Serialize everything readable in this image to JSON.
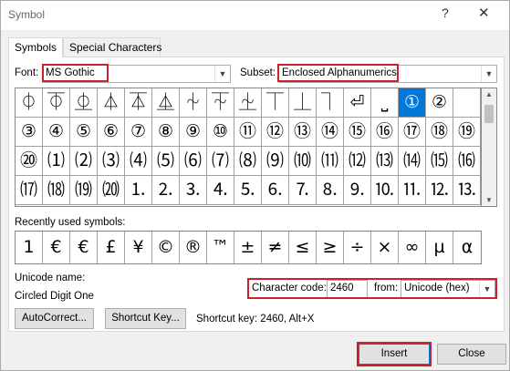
{
  "window": {
    "title": "Symbol",
    "help_glyph": "?",
    "close_glyph": "✕"
  },
  "tabs": [
    {
      "label": "Symbols",
      "active": true
    },
    {
      "label": "Special Characters",
      "active": false
    }
  ],
  "font": {
    "label": "Font:",
    "value": "MS Gothic"
  },
  "subset": {
    "label": "Subset:",
    "value": "Enclosed Alphanumerics"
  },
  "symbol_grid": {
    "cells": [
      "⏀",
      "⏁",
      "⏂",
      "⏃",
      "⏄",
      "⏅",
      "⏆",
      "⏇",
      "⏈",
      "⏉",
      "⏊",
      "⏋",
      "⏎",
      "⎵",
      "①",
      "②",
      "",
      "③",
      "④",
      "⑤",
      "⑥",
      "⑦",
      "⑧",
      "⑨",
      "⑩",
      "⑪",
      "⑫",
      "⑬",
      "⑭",
      "⑮",
      "⑯",
      "⑰",
      "⑱",
      "⑲",
      "⑳",
      "⑴",
      "⑵",
      "⑶",
      "⑷",
      "⑸",
      "⑹",
      "⑺",
      "⑻",
      "⑼",
      "⑽",
      "⑾",
      "⑿",
      "⒀",
      "⒁",
      "⒂",
      "⒃",
      "⒄",
      "⒅",
      "⒆",
      "⒇",
      "⒈",
      "⒉",
      "⒊",
      "⒋",
      "⒌",
      "⒍",
      "⒎",
      "⒏",
      "⒐",
      "⒑",
      "⒒",
      "⒓",
      "⒔"
    ],
    "selected_index": 14
  },
  "recent": {
    "label": "Recently used symbols:",
    "symbols": [
      "1",
      "€",
      "€",
      "£",
      "¥",
      "©",
      "®",
      "™",
      "±",
      "≠",
      "≤",
      "≥",
      "÷",
      "×",
      "∞",
      "µ",
      "α"
    ]
  },
  "unicode": {
    "name_label": "Unicode name:",
    "name_value": "Circled Digit One"
  },
  "char_code": {
    "label": "Character code:",
    "value": "2460",
    "from_label": "from:",
    "from_value": "Unicode (hex)"
  },
  "buttons": {
    "autocorrect": "AutoCorrect...",
    "shortcut_key": "Shortcut Key...",
    "insert": "Insert",
    "close": "Close"
  },
  "shortcut_text": "Shortcut key: 2460, Alt+X",
  "colors": {
    "highlight": "#c8232c",
    "selection": "#0078d7"
  }
}
